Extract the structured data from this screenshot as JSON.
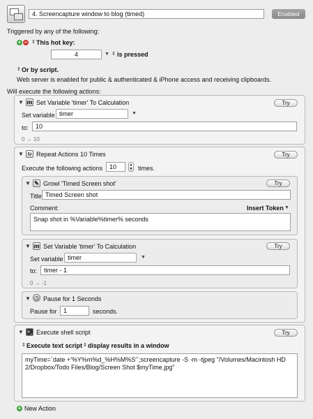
{
  "macro": {
    "name": "4. Screencapture window to blog (timed)",
    "enabled_label": "Enabled"
  },
  "trigger": {
    "header": "Triggered by any of the following:",
    "hot_key_label": "This hot key:",
    "hot_key_value": "4",
    "is_pressed_label": "is pressed",
    "or_by_script": "Or by script.",
    "web_server_note": "Web server is enabled for public & authenticated & iPhone access and receiving clipboards."
  },
  "actions_header": "Will execute the following actions:",
  "try_label": "Try",
  "set_var_1": {
    "title": "Set Variable 'timer' To Calculation",
    "set_variable_label": "Set variable",
    "variable": "timer",
    "to_label": "to:",
    "value": "10",
    "preview": "0 → 10"
  },
  "repeat": {
    "title": "Repeat Actions 10 Times",
    "execute_label": "Execute the following actions",
    "count": "10",
    "times_label": "times."
  },
  "growl": {
    "title": "Growl 'Timed Screen shot'",
    "title_label": "Title:",
    "title_value": "Timed Screen shot",
    "comment_label": "Comment:",
    "insert_token": "Insert Token",
    "comment_value": "Snap shot in %Variable%timer% seconds"
  },
  "set_var_2": {
    "title": "Set Variable 'timer' To Calculation",
    "set_variable_label": "Set variable",
    "variable": "timer",
    "to_label": "to:",
    "value": "timer - 1",
    "preview": "0 → -1"
  },
  "pause": {
    "title": "Pause for 1 Seconds",
    "pause_label": "Pause for",
    "value": "1",
    "seconds_label": "seconds."
  },
  "shell": {
    "title": "Execute shell script",
    "execute_text_script": "Execute text script",
    "display_results": "display results in a window",
    "script": "myTime=`date +'%Y%m%d_%H%M%S'`;screencapture -S -m -tjpeg \"/Volumes/Macintosh HD 2/Dropbox/Todo Files/Blog/Screen Shot $myTime.jpg\""
  },
  "new_action_label": "New Action",
  "icons": {
    "calc": "calculator-icon",
    "repeat": "repeat-icon",
    "growl": "growl-icon",
    "pause": "pause-clock-icon",
    "shell": "terminal-icon"
  }
}
